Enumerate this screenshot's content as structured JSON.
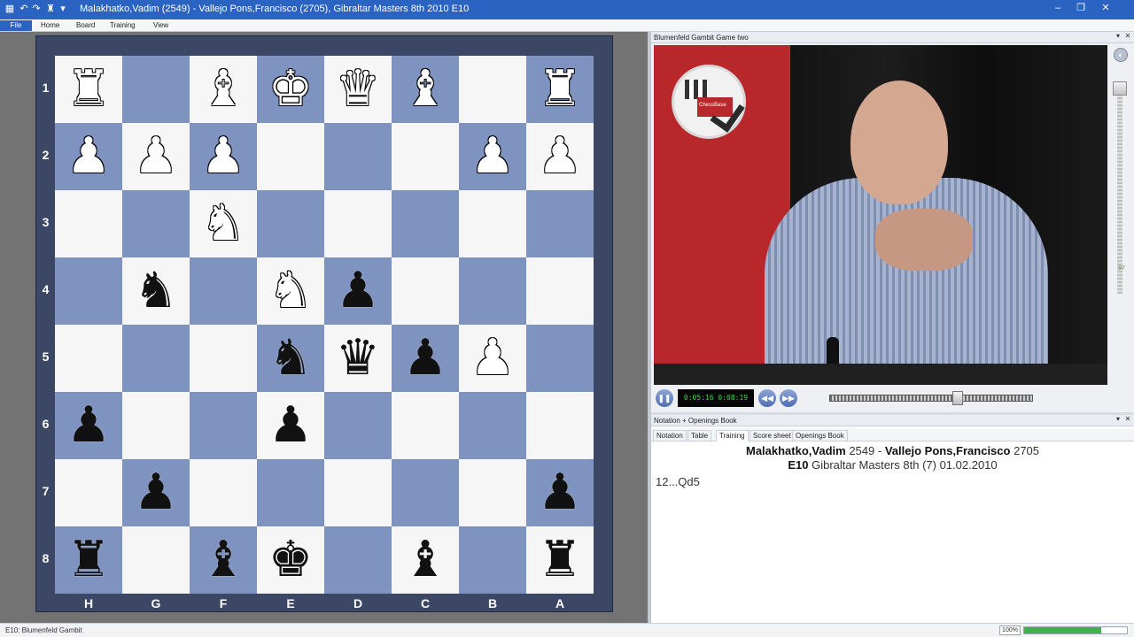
{
  "window": {
    "title": "Malakhatko,Vadim (2549) - Vallejo Pons,Francisco (2705), Gibraltar Masters 8th 2010  E10",
    "minimize": "‒",
    "restore": "❐",
    "close": "✕"
  },
  "menu": {
    "file": "File",
    "items": [
      "Home",
      "Board",
      "Training",
      "View"
    ]
  },
  "board": {
    "ranks": [
      "1",
      "2",
      "3",
      "4",
      "5",
      "6",
      "7",
      "8"
    ],
    "files": [
      "H",
      "G",
      "F",
      "E",
      "D",
      "C",
      "B",
      "A"
    ],
    "rows": [
      [
        "wR",
        "",
        "wB",
        "wK",
        "wQ",
        "wB",
        "",
        "wR"
      ],
      [
        "wP",
        "wP",
        "wP",
        "",
        "",
        "",
        "wP",
        "wP"
      ],
      [
        "",
        "",
        "wN",
        "",
        "",
        "",
        "",
        ""
      ],
      [
        "",
        "bN",
        "",
        "wN",
        "bP",
        "",
        "",
        ""
      ],
      [
        "",
        "",
        "",
        "bN",
        "bQ",
        "bP",
        "wP",
        ""
      ],
      [
        "bP",
        "",
        "",
        "bP",
        "",
        "",
        "",
        ""
      ],
      [
        "",
        "bP",
        "",
        "",
        "",
        "",
        "",
        "bP"
      ],
      [
        "bR",
        "",
        "bB",
        "bK",
        "",
        "bB",
        "",
        "bR"
      ]
    ],
    "colors": {
      "light": "#f6f6f6",
      "dark": "#7f93c0",
      "frame": "#3b4764"
    }
  },
  "video": {
    "panel_title": "Blumenfeld Gambit Game two",
    "logo_text": "ChessBase",
    "time": "0:05:16 0:08:19",
    "pause_icon": "❚❚",
    "rewind_icon": "◀◀",
    "forward_icon": "▶▶",
    "seek_fraction": 0.632,
    "volume_value": "97"
  },
  "notation": {
    "panel_title": "Notation + Openings Book",
    "tabs": [
      "Notation",
      "Table",
      "Training",
      "Score sheet",
      "Openings Book"
    ],
    "active_tab": "Training",
    "white_player": "Malakhatko,Vadim",
    "white_elo": "2549",
    "separator": "-",
    "black_player": "Vallejo Pons,Francisco",
    "black_elo": "2705",
    "eco": "E10",
    "event": "Gibraltar Masters 8th (7) 01.02.2010",
    "moves": "12...Qd5"
  },
  "status": {
    "text": "E10: Blumenfeld Gambit",
    "zoom": "100%",
    "progress": 0.75
  }
}
